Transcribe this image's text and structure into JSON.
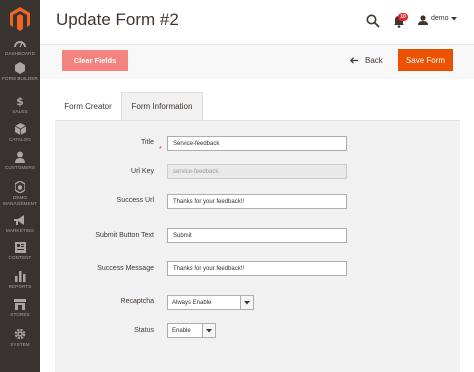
{
  "header": {
    "title": "Update Form #2",
    "notification_count": "10",
    "user_name": "demo"
  },
  "sidebar": {
    "items": [
      {
        "label": "DASHBOARD",
        "icon": "dashboard-icon"
      },
      {
        "label": "FORM BUILDER",
        "icon": "form-builder-icon"
      },
      {
        "label": "SALES",
        "icon": "dollar-icon"
      },
      {
        "label": "CATALOG",
        "icon": "catalog-icon"
      },
      {
        "label": "CUSTOMERS",
        "icon": "customers-icon"
      },
      {
        "label": "DEMO MANAGEMENT",
        "icon": "demo-management-icon"
      },
      {
        "label": "MARKETING",
        "icon": "megaphone-icon"
      },
      {
        "label": "CONTENT",
        "icon": "content-icon"
      },
      {
        "label": "REPORTS",
        "icon": "reports-icon"
      },
      {
        "label": "STORES",
        "icon": "stores-icon"
      },
      {
        "label": "SYSTEM",
        "icon": "gear-icon"
      }
    ]
  },
  "actions": {
    "clear_label": "Clear Fields",
    "back_label": "Back",
    "save_label": "Save Form"
  },
  "tabs": [
    {
      "label": "Form Creator"
    },
    {
      "label": "Form Information"
    }
  ],
  "form": {
    "title_label": "Title",
    "title_value": "Service-feedback",
    "url_key_label": "Url Key",
    "url_key_placeholder": "service-feedback",
    "success_url_label": "Success Url",
    "success_url_value": "Thanks for your feedback!!",
    "submit_text_label": "Submit Button Text",
    "submit_text_value": "Submit",
    "success_message_label": "Success Message",
    "success_message_value": "Thanks for your feedback!!",
    "recaptcha_label": "Recaptcha",
    "recaptcha_value": "Always Enable",
    "status_label": "Status",
    "status_value": "Enable"
  },
  "colors": {
    "sidebar": "#373330",
    "accent": "#eb5202",
    "clear_button": "#f2837e",
    "badge": "#e22626"
  }
}
